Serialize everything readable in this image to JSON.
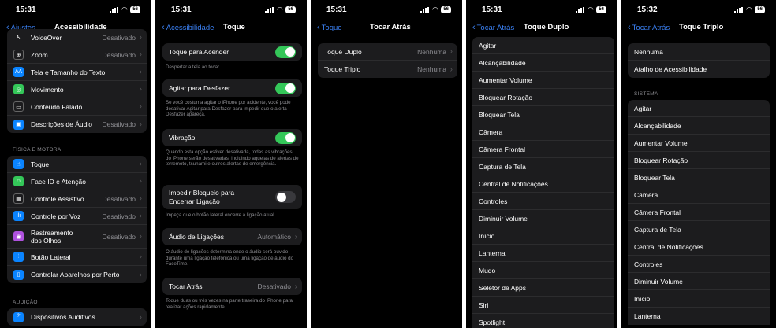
{
  "panel1": {
    "time": "15:31",
    "battery": "56",
    "back_label": "Ajustes",
    "title": "Acessibilidade",
    "vision_items": [
      {
        "label": "VoiceOver",
        "value": "Desativado"
      },
      {
        "label": "Zoom",
        "value": "Desativado"
      },
      {
        "label": "Tela e Tamanho do Texto",
        "value": ""
      },
      {
        "label": "Movimento",
        "value": ""
      },
      {
        "label": "Conteúdo Falado",
        "value": ""
      },
      {
        "label": "Descrições de Áudio",
        "value": "Desativado"
      }
    ],
    "physical_header": "FÍSICA E MOTORA",
    "physical_items": [
      {
        "label": "Toque",
        "value": ""
      },
      {
        "label": "Face ID e Atenção",
        "value": ""
      },
      {
        "label": "Controle Assistivo",
        "value": "Desativado"
      },
      {
        "label": "Controle por Voz",
        "value": "Desativado"
      },
      {
        "label_line1": "Rastreamento",
        "label_line2": "dos Olhos",
        "value": "Desativado"
      },
      {
        "label": "Botão Lateral",
        "value": ""
      },
      {
        "label": "Controlar Aparelhos por Perto",
        "value": ""
      }
    ],
    "hearing_header": "AUDIÇÃO",
    "hearing_items": [
      {
        "label": "Dispositivos Auditivos",
        "value": ""
      }
    ]
  },
  "panel2": {
    "time": "15:31",
    "battery": "56",
    "back_label": "Acessibilidade",
    "title": "Toque",
    "tap_to_wake": "Toque para Acender",
    "tap_to_wake_note": "Despertar a tela ao tocar.",
    "shake_undo": "Agitar para Desfazer",
    "shake_undo_note": "Se você costuma agitar o iPhone por acidente, você pode desativar Agitar para Desfazer para impedir que o alerta Desfazer apareça.",
    "vibration": "Vibração",
    "vibration_note": "Quando esta opção estiver desativada, todas as vibrações do iPhone serão desativadas, incluindo aquelas de alertas de terremoto, tsunami e outros alertas de emergência.",
    "prevent_lock_line1": "Impedir Bloqueio para",
    "prevent_lock_line2": "Encerrar Ligação",
    "prevent_lock_note": "Impeça que o botão lateral encerre a ligação atual.",
    "call_audio": "Áudio de Ligações",
    "call_audio_value": "Automático",
    "call_audio_note": "O áudio de ligações determina onde o áudio será ouvido durante uma ligação telefônica ou uma ligação de áudio do FaceTime.",
    "back_tap": "Tocar Atrás",
    "back_tap_value": "Desativado",
    "back_tap_note": "Toque duas ou três vezes na parte traseira do iPhone para realizar ações rapidamente.",
    "toggles": {
      "tap_to_wake": true,
      "shake_undo": true,
      "vibration": true,
      "prevent_lock": false
    }
  },
  "panel3": {
    "time": "15:31",
    "battery": "56",
    "back_label": "Toque",
    "title": "Tocar Atrás",
    "items": [
      {
        "label": "Toque Duplo",
        "value": "Nenhuma"
      },
      {
        "label": "Toque Triplo",
        "value": "Nenhuma"
      }
    ]
  },
  "panel4": {
    "time": "15:31",
    "battery": "56",
    "back_label": "Tocar Atrás",
    "title": "Toque Duplo",
    "items": [
      "Agitar",
      "Alcançabilidade",
      "Aumentar Volume",
      "Bloquear Rotação",
      "Bloquear Tela",
      "Câmera",
      "Câmera Frontal",
      "Captura de Tela",
      "Central de Notificações",
      "Controles",
      "Diminuir Volume",
      "Início",
      "Lanterna",
      "Mudo",
      "Seletor de Apps",
      "Siri",
      "Spotlight"
    ]
  },
  "panel5": {
    "time": "15:32",
    "battery": "56",
    "back_label": "Tocar Atrás",
    "title": "Toque Triplo",
    "top_items": [
      "Nenhuma",
      "Atalho de Acessibilidade"
    ],
    "system_header": "SISTEMA",
    "items": [
      "Agitar",
      "Alcançabilidade",
      "Aumentar Volume",
      "Bloquear Rotação",
      "Bloquear Tela",
      "Câmera",
      "Câmera Frontal",
      "Captura de Tela",
      "Central de Notificações",
      "Controles",
      "Diminuir Volume",
      "Início",
      "Lanterna"
    ]
  },
  "colors": {
    "accent": "#3b82f6",
    "toggle_on": "#34c759",
    "background": "#000000",
    "cell": "#1c1c1e"
  }
}
